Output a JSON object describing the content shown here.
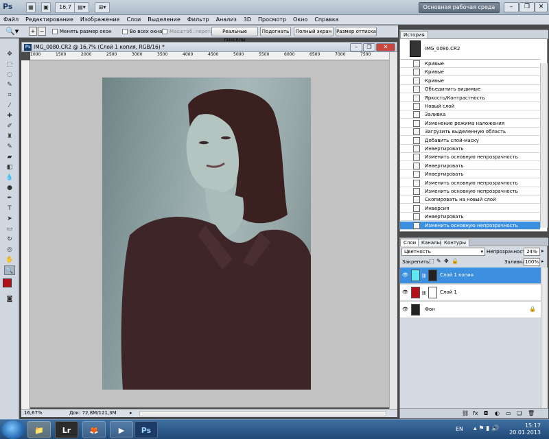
{
  "app": {
    "logo": "Ps",
    "zoom_value": "16,7",
    "workspace": "Основная рабочая среда"
  },
  "menu": [
    "Файл",
    "Редактирование",
    "Изображение",
    "Слои",
    "Выделение",
    "Фильтр",
    "Анализ",
    "3D",
    "Просмотр",
    "Окно",
    "Справка"
  ],
  "options": {
    "resize_windows": "Менять размер окон",
    "all_windows": "Во всех окнах",
    "scrubby_zoom": "Масштаб. перетаскиванием",
    "actual_pixels": "Реальные пикселы",
    "fit_screen": "Подогнать",
    "full_screen": "Полный экран",
    "print_size": "Размер оттиска"
  },
  "document": {
    "tab_icon": "Ps",
    "title": "IMG_0080.CR2 @ 16,7% (Слой 1 копия, RGB/16) *",
    "ruler_top": [
      "1000",
      "1500",
      "2000",
      "2500",
      "3000",
      "3500",
      "4000",
      "4500",
      "5000",
      "5500",
      "6000",
      "6500",
      "7000",
      "7500"
    ],
    "zoom": "16,67%",
    "doc_size": "Док: 72,8M/121,3M"
  },
  "history": {
    "tab": "История",
    "snapshot": "IMG_0080.CR2",
    "items": [
      "Кривые",
      "Кривые",
      "Кривые",
      "Объединить видимые",
      "Яркость/Контрастность",
      "Новый слой",
      "Заливка",
      "Изменение режима наложения",
      "Загрузить выделенную область",
      "Добавить слой-маску",
      "Инвертировать",
      "Изменить основную непрозрачность",
      "Инвертировать",
      "Инвертировать",
      "Изменить основную непрозрачность",
      "Изменить основную непрозрачность",
      "Скопировать на новый слой",
      "Инверсия",
      "Инвертировать",
      "Изменить основную непрозрачность"
    ],
    "selected_index": 19
  },
  "layers": {
    "tabs": [
      "Слои",
      "Каналы",
      "Контуры"
    ],
    "blend_mode": "Цветность",
    "opacity_label": "Непрозрачность:",
    "opacity_value": "24%",
    "lock_label": "Закрепить:",
    "fill_label": "Заливка:",
    "fill_value": "100%",
    "items": [
      {
        "name": "Слой 1 копия",
        "color": "#5fe8f0",
        "selected": true
      },
      {
        "name": "Слой 1",
        "color": "#b3121b",
        "selected": false
      },
      {
        "name": "Фон",
        "color": "#222222",
        "selected": false
      }
    ]
  },
  "colors": {
    "foreground": "#b3121b",
    "background": "#ffffff",
    "selection": "#3d8fe0"
  },
  "taskbar": {
    "apps": [
      "Lr",
      "Ps"
    ],
    "lang": "EN",
    "time": "15:17",
    "date": "20.01.2013"
  }
}
